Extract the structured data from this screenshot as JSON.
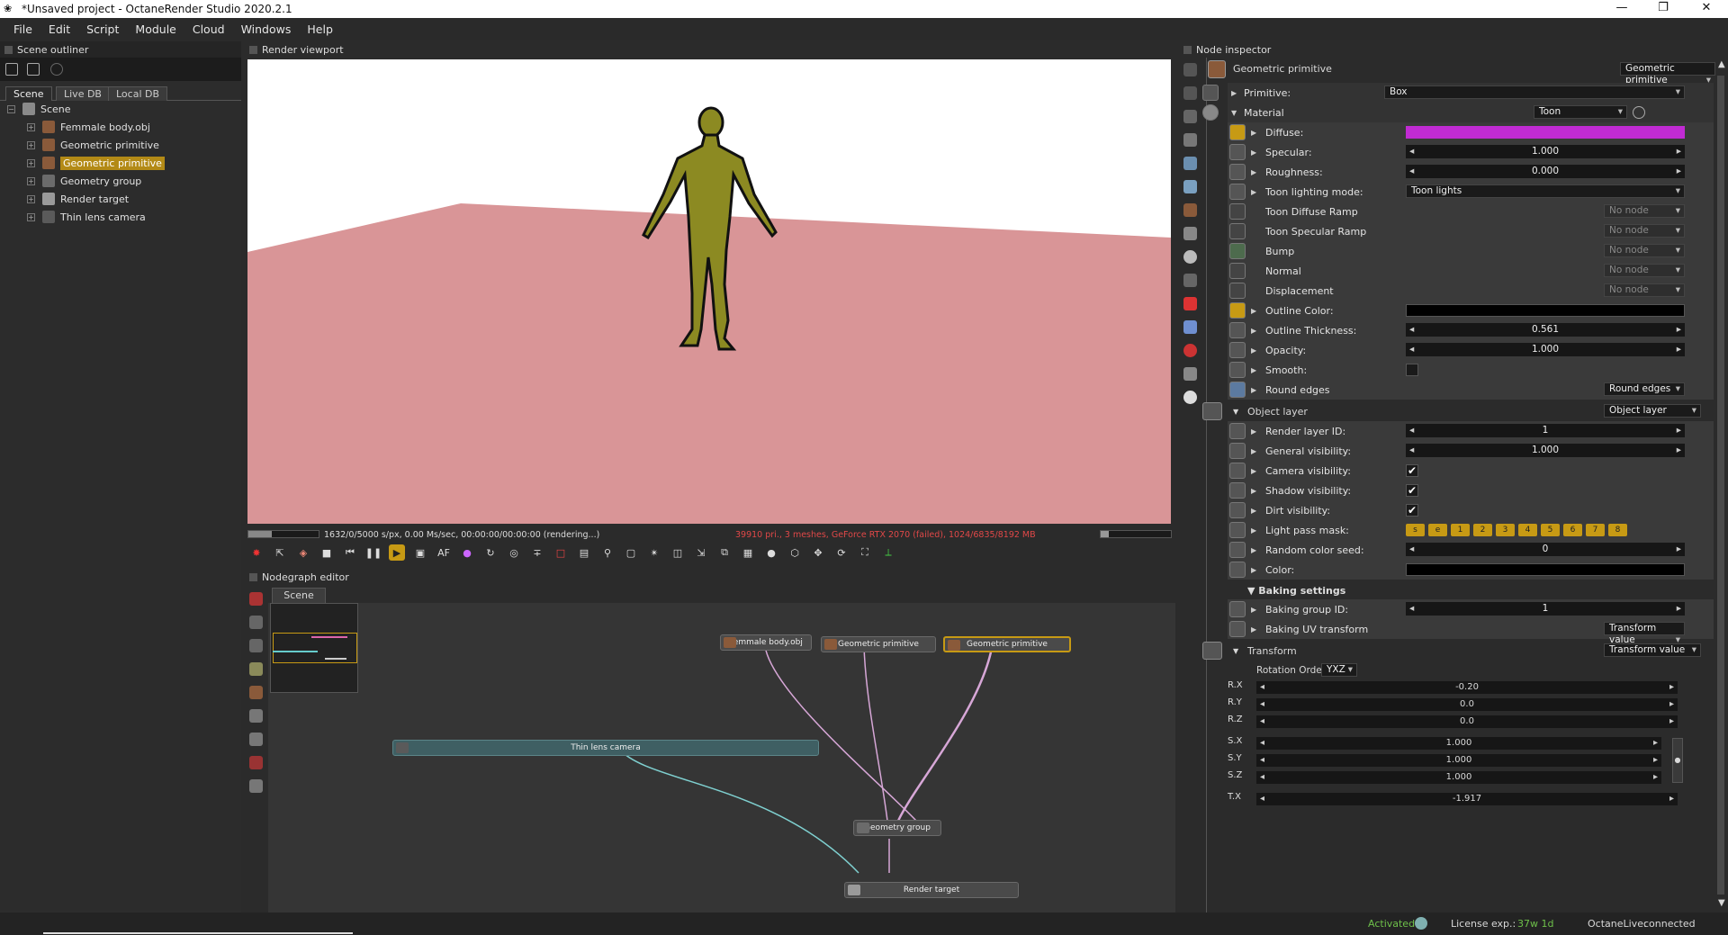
{
  "window": {
    "title": "*Unsaved project - OctaneRender Studio 2020.2.1",
    "minimize": "—",
    "restore": "❐",
    "close": "✕"
  },
  "menu": [
    "File",
    "Edit",
    "Script",
    "Module",
    "Cloud",
    "Windows",
    "Help"
  ],
  "outliner": {
    "title": "Scene outliner",
    "tabs": [
      "Scene",
      "Live DB",
      "Local DB"
    ],
    "root": "Scene",
    "items": [
      "Femmale body.obj",
      "Geometric primitive",
      "Geometric primitive",
      "Geometry group",
      "Render target",
      "Thin lens camera"
    ]
  },
  "viewport": {
    "title": "Render viewport",
    "stats_left": "1632/0/5000 s/px, 0.00 Ms/sec, 00:00:00/00:00:00 (rendering...)",
    "stats_right": "39910 pri., 3 meshes, GeForce RTX 2070 (failed), 1024/6835/8192 MB",
    "progress": 0.33
  },
  "nodegraph": {
    "title": "Nodegraph editor",
    "tab": "Scene",
    "nodes": {
      "femmale": "Femmale body.obj",
      "geo1": "Geometric primitive",
      "geo2": "Geometric primitive",
      "camera": "Thin lens camera",
      "group": "Geometry group",
      "target": "Render target"
    }
  },
  "inspector": {
    "title": "Node inspector",
    "node_name": "Geometric primitive",
    "node_type": "Geometric primitive",
    "primitive_label": "Primitive:",
    "primitive_value": "Box",
    "material_label": "Material",
    "material_value": "Toon",
    "params": {
      "diffuse": "Diffuse:",
      "specular": "Specular:",
      "specular_v": "1.000",
      "roughness": "Roughness:",
      "roughness_v": "0.000",
      "tlm": "Toon lighting mode:",
      "tlm_v": "Toon lights",
      "tdr": "Toon Diffuse Ramp",
      "tsr": "Toon Specular Ramp",
      "bump": "Bump",
      "normal": "Normal",
      "disp": "Displacement",
      "no_node": "No node",
      "outline_color": "Outline Color:",
      "outline_thick": "Outline Thickness:",
      "outline_thick_v": "0.561",
      "opacity": "Opacity:",
      "opacity_v": "1.000",
      "smooth": "Smooth:",
      "round_edges": "Round edges",
      "round_edges_v": "Round edges"
    },
    "object_layer": {
      "label": "Object layer",
      "value": "Object layer",
      "rlid": "Render layer ID:",
      "rlid_v": "1",
      "gvis": "General visibility:",
      "gvis_v": "1.000",
      "cvis": "Camera visibility:",
      "svis": "Shadow visibility:",
      "dvis": "Dirt visibility:",
      "lpm": "Light pass mask:",
      "lpm_v": [
        "s",
        "e",
        "1",
        "2",
        "3",
        "4",
        "5",
        "6",
        "7",
        "8"
      ],
      "rcs": "Random color seed:",
      "rcs_v": "0",
      "color": "Color:"
    },
    "baking": {
      "label": "▼ Baking settings",
      "bgid": "Baking group ID:",
      "bgid_v": "1",
      "buv": "Baking UV transform",
      "buv_v": "Transform value"
    },
    "transform": {
      "label": "Transform",
      "value": "Transform value",
      "rot_order_label": "Rotation Order",
      "rot_order": "YXZ",
      "rows": [
        {
          "k": "R.X",
          "v": "-0.20"
        },
        {
          "k": "R.Y",
          "v": "0.0"
        },
        {
          "k": "R.Z",
          "v": "0.0"
        },
        {
          "k": "S.X",
          "v": "1.000"
        },
        {
          "k": "S.Y",
          "v": "1.000"
        },
        {
          "k": "S.Z",
          "v": "1.000"
        },
        {
          "k": "T.X",
          "v": "-1.917"
        }
      ]
    },
    "check": "✔"
  },
  "status": {
    "activated": "Activated",
    "license_label": "License exp.:",
    "license_value": "37w 1d",
    "live_label": "OctaneLive:",
    "live_value": "connected"
  },
  "colors": {
    "diffuse": "#c12bd3",
    "accent": "#c79a14",
    "ground": "#d99597",
    "figure": "#8c8a22"
  }
}
